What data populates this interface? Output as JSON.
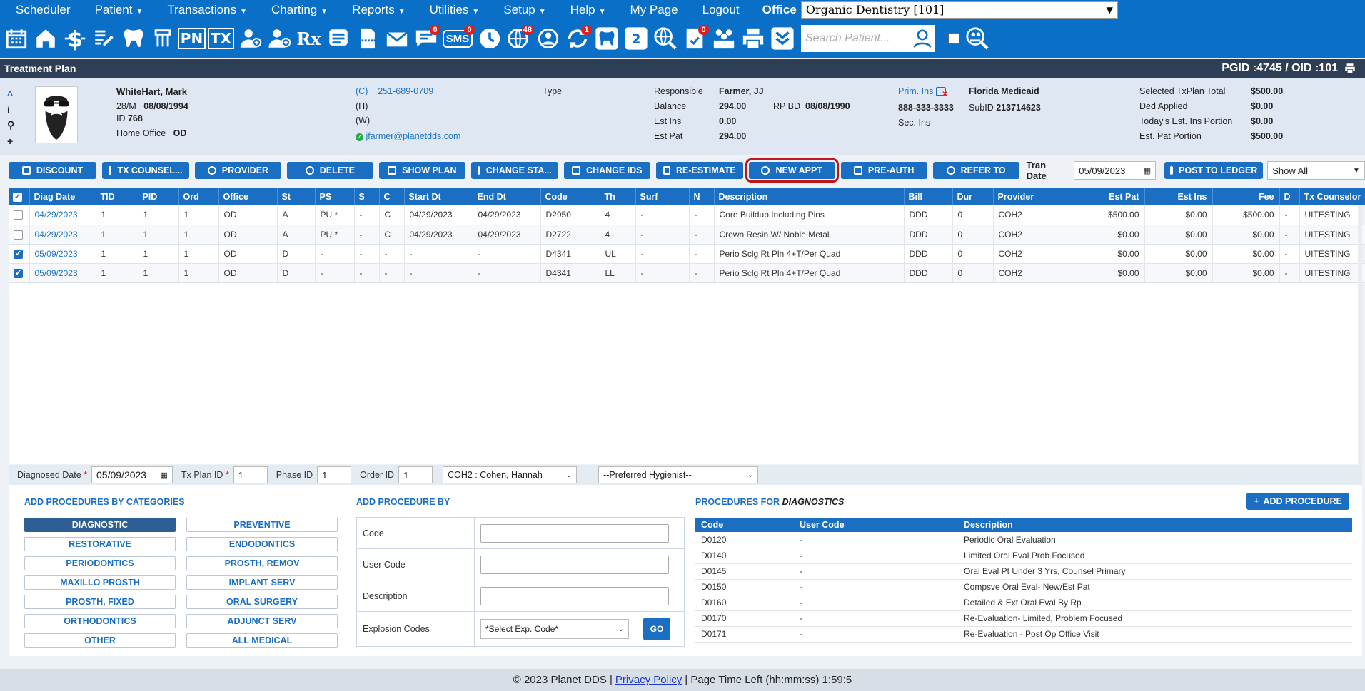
{
  "menu": {
    "items": [
      {
        "label": "Scheduler",
        "caret": false
      },
      {
        "label": "Patient",
        "caret": true
      },
      {
        "label": "Transactions",
        "caret": true
      },
      {
        "label": "Charting",
        "caret": true
      },
      {
        "label": "Reports",
        "caret": true
      },
      {
        "label": "Utilities",
        "caret": true
      },
      {
        "label": "Setup",
        "caret": true
      },
      {
        "label": "Help",
        "caret": true
      },
      {
        "label": "My Page",
        "caret": false
      },
      {
        "label": "Logout",
        "caret": false
      }
    ],
    "office_label": "Office",
    "office_value": "Organic Dentistry [101]"
  },
  "toolbar": {
    "text_icons": {
      "pn": "PN",
      "tx": "TX",
      "rx": "Rx",
      "sms": "SMS"
    },
    "badges": {
      "messages": "0",
      "sms": "0",
      "web": "48",
      "sync": "1",
      "forms": "0"
    },
    "search_placeholder": "Search Patient..."
  },
  "page": {
    "title": "Treatment Plan",
    "ids": "PGID :4745  /  OID :101"
  },
  "patient": {
    "name": "WhiteHart, Mark",
    "age_sex": "28/M",
    "dob": "08/08/1994",
    "id_label": "ID",
    "id": "768",
    "home_office_label": "Home Office",
    "home_office": "OD",
    "phone_c_label": "(C)",
    "phone_c": "251-689-0709",
    "phone_h_label": "(H)",
    "phone_w_label": "(W)",
    "email": "jfarmer@planetdds.com",
    "type_label": "Type",
    "responsible_label": "Responsible",
    "responsible": "Farmer, JJ",
    "balance_label": "Balance",
    "balance": "294.00",
    "rp_bd_label": "RP BD",
    "rp_bd": "08/08/1990",
    "est_ins_label": "Est Ins",
    "est_ins": "0.00",
    "est_pat_label": "Est Pat",
    "est_pat": "294.00",
    "prim_ins_label": "Prim. Ins",
    "prim_ins": "Florida Medicaid",
    "ins_phone": "888-333-3333",
    "subid_label": "SubID",
    "subid": "213714623",
    "sec_ins_label": "Sec. Ins",
    "summary": [
      {
        "label": "Selected TxPlan Total",
        "value": "$500.00"
      },
      {
        "label": "Ded Applied",
        "value": "$0.00"
      },
      {
        "label": "Today's Est. Ins Portion",
        "value": "$0.00"
      },
      {
        "label": "Est. Pat Portion",
        "value": "$500.00"
      }
    ]
  },
  "actions": {
    "discount": "DISCOUNT",
    "tx_counsel": "TX COUNSEL...",
    "provider": "PROVIDER",
    "delete": "DELETE",
    "show_plan": "SHOW PLAN",
    "change_status": "CHANGE STA...",
    "change_ids": "CHANGE IDS",
    "re_estimate": "RE-ESTIMATE",
    "new_appt": "NEW APPT",
    "pre_auth": "PRE-AUTH",
    "refer_to": "REFER TO",
    "tran_date_label": "Tran Date",
    "tran_date": "05/09/2023",
    "post_to_ledger": "POST TO LEDGER",
    "show_filter": "Show All"
  },
  "grid": {
    "headers": [
      "Diag Date",
      "TID",
      "PID",
      "Ord",
      "Office",
      "St",
      "PS",
      "S",
      "C",
      "Start Dt",
      "End Dt",
      "Code",
      "Th",
      "Surf",
      "N",
      "Description",
      "Bill",
      "Dur",
      "Provider",
      "Est Pat",
      "Est Ins",
      "Fee",
      "D",
      "Tx Counselor"
    ],
    "rows": [
      {
        "checked": false,
        "cells": [
          "04/29/2023",
          "1",
          "1",
          "1",
          "OD",
          "A",
          "PU *",
          "-",
          "C",
          "04/29/2023",
          "04/29/2023",
          "D2950",
          "4",
          "-",
          "-",
          "Core Buildup Including Pins",
          "DDD",
          "0",
          "COH2",
          "$500.00",
          "$0.00",
          "$500.00",
          "-",
          "UITESTING"
        ]
      },
      {
        "checked": false,
        "cells": [
          "04/29/2023",
          "1",
          "1",
          "1",
          "OD",
          "A",
          "PU *",
          "-",
          "C",
          "04/29/2023",
          "04/29/2023",
          "D2722",
          "4",
          "-",
          "-",
          "Crown Resin W/ Noble Metal",
          "DDD",
          "0",
          "COH2",
          "$0.00",
          "$0.00",
          "$0.00",
          "-",
          "UITESTING"
        ]
      },
      {
        "checked": true,
        "cells": [
          "05/09/2023",
          "1",
          "1",
          "1",
          "OD",
          "D",
          "-",
          "-",
          "-",
          "-",
          "-",
          "D4341",
          "UL",
          "-",
          "-",
          "Perio Sclg Rt Pln 4+T/Per Quad",
          "DDD",
          "0",
          "COH2",
          "$0.00",
          "$0.00",
          "$0.00",
          "-",
          "UITESTING"
        ]
      },
      {
        "checked": true,
        "cells": [
          "05/09/2023",
          "1",
          "1",
          "1",
          "OD",
          "D",
          "-",
          "-",
          "-",
          "-",
          "-",
          "D4341",
          "LL",
          "-",
          "-",
          "Perio Sclg Rt Pln 4+T/Per Quad",
          "DDD",
          "0",
          "COH2",
          "$0.00",
          "$0.00",
          "$0.00",
          "-",
          "UITESTING"
        ]
      }
    ]
  },
  "form": {
    "diag_date_label": "Diagnosed Date",
    "diag_date": "05/09/2023",
    "txplan_id_label": "Tx Plan ID",
    "txplan_id": "1",
    "phase_id_label": "Phase ID",
    "phase_id": "1",
    "order_id_label": "Order ID",
    "order_id": "1",
    "provider": "COH2 : Cohen, Hannah",
    "hygienist": "--Preferred Hygienist--"
  },
  "categories": {
    "title": "ADD PROCEDURES BY CATEGORIES",
    "left": [
      "DIAGNOSTIC",
      "RESTORATIVE",
      "PERIODONTICS",
      "MAXILLO PROSTH",
      "PROSTH, FIXED",
      "ORTHODONTICS",
      "OTHER"
    ],
    "right": [
      "PREVENTIVE",
      "ENDODONTICS",
      "PROSTH, REMOV",
      "IMPLANT SERV",
      "ORAL SURGERY",
      "ADJUNCT SERV",
      "ALL MEDICAL"
    ]
  },
  "add_by": {
    "title": "ADD PROCEDURE BY",
    "code_label": "Code",
    "user_code_label": "User Code",
    "description_label": "Description",
    "explosion_label": "Explosion Codes",
    "explosion_value": "*Select Exp. Code*",
    "go": "GO"
  },
  "procedures": {
    "title_prefix": "PROCEDURES FOR",
    "title_category": "DIAGNOSTICS",
    "add_button": "ADD PROCEDURE",
    "headers": [
      "Code",
      "User Code",
      "Description"
    ],
    "rows": [
      [
        "D0120",
        "-",
        "Periodic Oral Evaluation"
      ],
      [
        "D0140",
        "-",
        "Limited Oral Eval Prob Focused"
      ],
      [
        "D0145",
        "-",
        "Oral Eval Pt Under 3 Yrs, Counsel Primary"
      ],
      [
        "D0150",
        "-",
        "Compsve Oral Eval- New/Est Pat"
      ],
      [
        "D0160",
        "-",
        "Detailed & Ext Oral Eval By Rp"
      ],
      [
        "D0170",
        "-",
        "Re-Evaluation- Limited, Problem Focused"
      ],
      [
        "D0171",
        "-",
        "Re-Evaluation - Post Op Office Visit"
      ]
    ]
  },
  "footer": {
    "copyright": "© 2023 Planet DDS |",
    "privacy": "Privacy Policy",
    "page_time": "|  Page Time Left (hh:mm:ss) 1:59:5"
  },
  "colors": {
    "primary": "#0a6fc7",
    "header": "#2e3e55",
    "highlight": "#c0161b"
  }
}
